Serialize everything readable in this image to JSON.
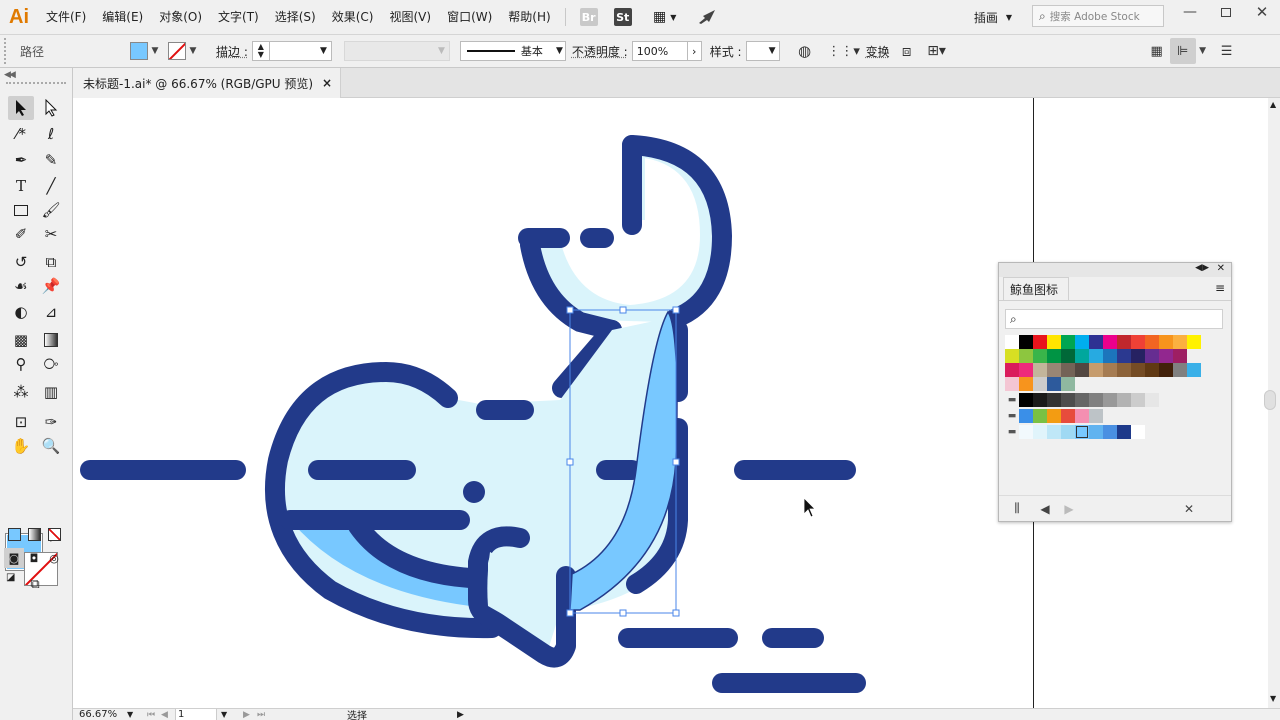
{
  "app": {
    "logo": "Ai"
  },
  "menu": [
    "文件(F)",
    "编辑(E)",
    "对象(O)",
    "文字(T)",
    "选择(S)",
    "效果(C)",
    "视图(V)",
    "窗口(W)",
    "帮助(H)"
  ],
  "menubar_icons": {
    "bridge": "Br",
    "stock": "St"
  },
  "workspace": "插画",
  "search_stock": {
    "placeholder": "搜索 Adobe Stock"
  },
  "control": {
    "selection_label": "路径",
    "stroke_label": "描边 :",
    "stroke_style": "基本",
    "opacity_label": "不透明度 :",
    "opacity_value": "100%",
    "style_label": "样式 :",
    "transform_label": "变换"
  },
  "document": {
    "tab_title": "未标题-1.ai* @ 66.67% (RGB/GPU 预览)",
    "close": "×"
  },
  "status": {
    "zoom": "66.67%",
    "artboard": "1",
    "tool": "选择"
  },
  "swatches_panel": {
    "title": "鲸鱼图标",
    "rows": [
      [
        "#ffffff",
        "#000000",
        "#e8141c",
        "#ffe500",
        "#00a651",
        "#00aeef",
        "#2e3192",
        "#ec008c",
        "#c1272d",
        "#ef4136",
        "#f26522",
        "#f7941d",
        "#fbb040",
        "#fff200"
      ],
      [
        "#d7df23",
        "#8dc63f",
        "#39b54a",
        "#009444",
        "#006838",
        "#00a79d",
        "#27aae1",
        "#1c75bc",
        "#2b3990",
        "#262262",
        "#662d91",
        "#92278f",
        "#9e1f63"
      ],
      [
        "#da1c5c",
        "#ee2a7b",
        "#c2b59b",
        "#998675",
        "#736357",
        "#534741",
        "#c69c6d",
        "#a67c52",
        "#8c6239",
        "#754c24",
        "#603913",
        "#42210b",
        "#808080",
        "#3ab0e8"
      ],
      [
        "#f4c6d3",
        "#f7941d",
        "#cccccc",
        "#2d5a9c",
        "#8fb8a0"
      ],
      [
        "#000000",
        "#1a1a1a",
        "#333333",
        "#4d4d4d",
        "#666666",
        "#808080",
        "#999999",
        "#b3b3b3",
        "#cccccc",
        "#e6e6e6"
      ],
      [
        "#3a8fe8",
        "#7ac143",
        "#f39c12",
        "#e74c3c",
        "#f48fb1",
        "#bdc3c7"
      ],
      [
        "#f2f9fd",
        "#e0f4fb",
        "#bfe7f7",
        "#9fd9f3",
        "#78c8ff",
        "#60b3f0",
        "#4a90e2",
        "#1e3a8a",
        "#ffffff"
      ]
    ]
  },
  "colors": {
    "whale_dark": "#223a8a",
    "whale_light": "#daf4fb",
    "whale_blue": "#78c8ff",
    "fill_swatch": "#78c8ff"
  }
}
